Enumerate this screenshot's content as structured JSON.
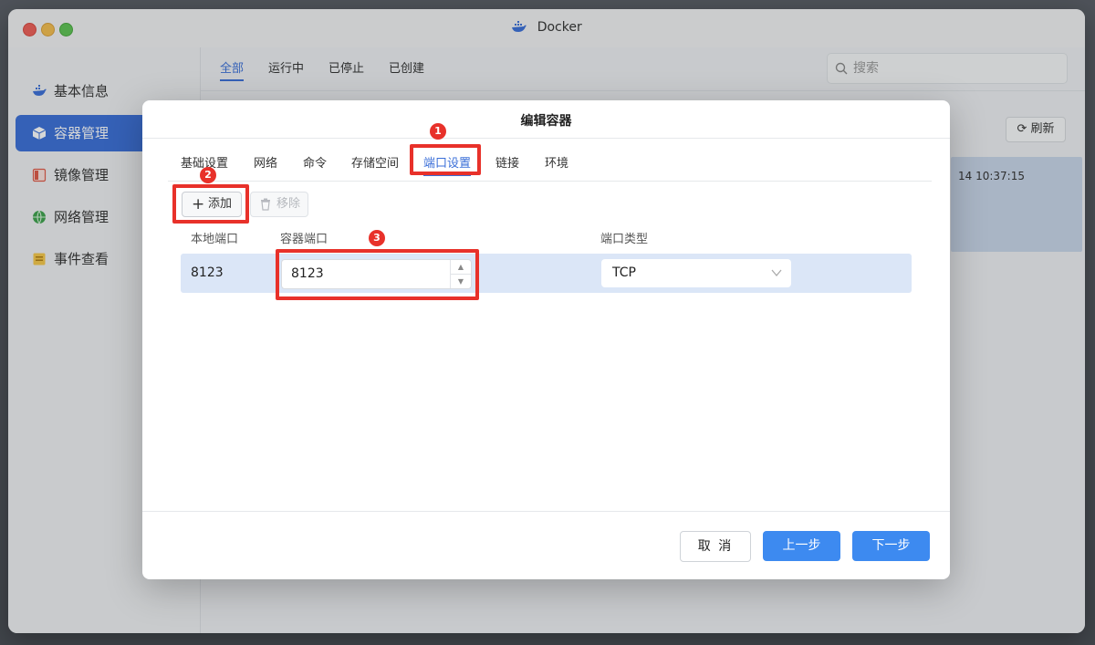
{
  "window": {
    "title": "Docker",
    "app_icon": "docker-whale-icon"
  },
  "sidebar": {
    "items": [
      {
        "label": "基本信息",
        "icon": "docker-icon",
        "active": false
      },
      {
        "label": "容器管理",
        "icon": "container-cube-icon",
        "active": true
      },
      {
        "label": "镜像管理",
        "icon": "image-book-icon",
        "active": false
      },
      {
        "label": "网络管理",
        "icon": "globe-icon",
        "active": false
      },
      {
        "label": "事件查看",
        "icon": "event-log-icon",
        "active": false
      }
    ]
  },
  "main": {
    "tabs": [
      "全部",
      "运行中",
      "已停止",
      "已创建"
    ],
    "active_tab": "全部",
    "search_placeholder": "搜索",
    "refresh_label": "刷新",
    "row_time_partial": "14 10:37:15"
  },
  "modal": {
    "title": "编辑容器",
    "tabs": [
      "基础设置",
      "网络",
      "命令",
      "存储空间",
      "端口设置",
      "链接",
      "环境"
    ],
    "active_tab": "端口设置",
    "add_label": "添加",
    "remove_label": "移除",
    "columns": {
      "local_port": "本地端口",
      "container_port": "容器端口",
      "port_type": "端口类型"
    },
    "row": {
      "local_port": "8123",
      "container_port": "8123",
      "port_type": "TCP"
    },
    "cancel_label": "取 消",
    "prev_label": "上一步",
    "next_label": "下一步"
  },
  "annotations": {
    "color": "#e8312a",
    "markers": [
      "1",
      "2",
      "3"
    ]
  },
  "colors": {
    "accent": "#3b6fd8",
    "primary_button": "#3d8af0",
    "row_highlight": "#dbe6f7"
  }
}
